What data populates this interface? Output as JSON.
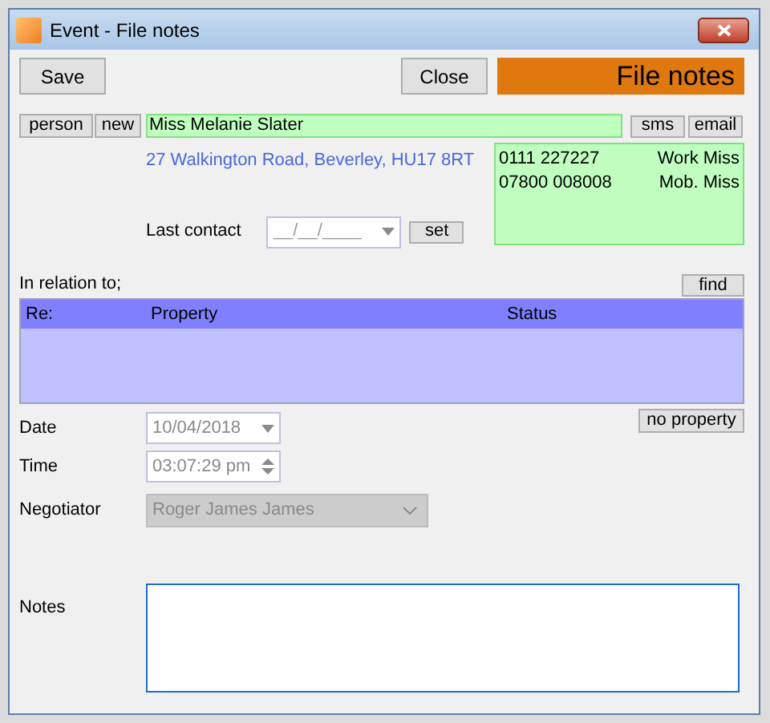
{
  "window": {
    "title": "Event - File notes"
  },
  "toolbar": {
    "save": "Save",
    "close": "Close",
    "banner": "File notes"
  },
  "contact": {
    "person_button": "person",
    "new_button": "new",
    "name": "Miss Melanie Slater",
    "sms_button": "sms",
    "email_button": "email",
    "address": "27 Walkington Road, Beverley, HU17 8RT",
    "last_contact_label": "Last contact",
    "last_contact_placeholder": "__/__/____",
    "set_button": "set"
  },
  "phones": [
    {
      "number": "0111 227227",
      "label": "Work Miss"
    },
    {
      "number": "07800 008008",
      "label": "Mob. Miss"
    }
  ],
  "relation": {
    "label": "In relation to;",
    "find_button": "find",
    "columns": [
      "Re:",
      "Property",
      "Status"
    ],
    "no_property_button": "no property"
  },
  "date": {
    "label": "Date",
    "value": "10/04/2018"
  },
  "time": {
    "label": "Time",
    "value": "03:07:29 pm"
  },
  "negotiator": {
    "label": "Negotiator",
    "value": "Roger James James",
    "disabled": true
  },
  "notes": {
    "label": "Notes"
  }
}
